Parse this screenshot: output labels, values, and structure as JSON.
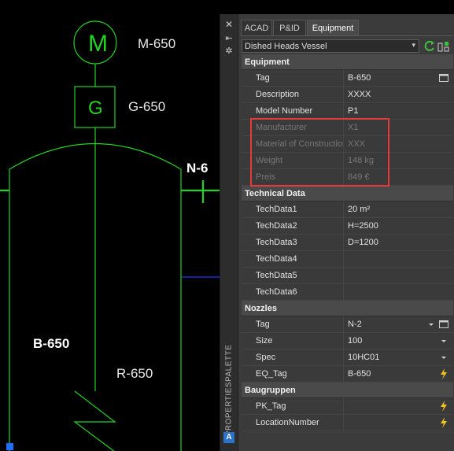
{
  "drawing": {
    "motor_symbol": "M",
    "motor_tag": "M-650",
    "gear_symbol": "G",
    "gear_tag": "G-650",
    "nozzle_tag": "N-6",
    "vessel_tag": "B-650",
    "agitator_tag": "R-650"
  },
  "palette": {
    "vertical_title": "PROPERTIESPALETTE",
    "close_glyph": "✕",
    "pin_glyph": "⇤",
    "settings_glyph": "✲",
    "logo_letter": "A",
    "tabs": [
      {
        "label": "ACAD",
        "active": false
      },
      {
        "label": "P&ID",
        "active": false
      },
      {
        "label": "Equipment",
        "active": true
      }
    ],
    "selector_value": "Dished Heads Vessel",
    "selector_arrow": "▾",
    "sections": {
      "equipment": {
        "title": "Equipment",
        "rows": [
          {
            "key": "Tag",
            "value": "B-650",
            "icon": "dialog-icon"
          },
          {
            "key": "Description",
            "value": "XXXX"
          },
          {
            "key": "Model Number",
            "value": "P1"
          },
          {
            "key": "Manufacturer",
            "value": "X1",
            "dim": true
          },
          {
            "key": "Material of Construction",
            "value": "XXX",
            "dim": true
          },
          {
            "key": "Weight",
            "value": "148 kg",
            "dim": true
          },
          {
            "key": "Preis",
            "value": "849 €",
            "dim": true
          }
        ]
      },
      "technical": {
        "title": "Technical Data",
        "rows": [
          {
            "key": "TechData1",
            "value": "20 m²"
          },
          {
            "key": "TechData2",
            "value": "H=2500"
          },
          {
            "key": "TechData3",
            "value": "D=1200"
          },
          {
            "key": "TechData4",
            "value": ""
          },
          {
            "key": "TechData5",
            "value": ""
          },
          {
            "key": "TechData6",
            "value": ""
          }
        ]
      },
      "nozzles": {
        "title": "Nozzles",
        "rows": [
          {
            "key": "Tag",
            "value": "N-2",
            "icon": "dropdown-dialog-icon"
          },
          {
            "key": "Size",
            "value": "100",
            "icon": "dropdown-icon"
          },
          {
            "key": "Spec",
            "value": "10HC01",
            "icon": "dropdown-icon"
          },
          {
            "key": "EQ_Tag",
            "value": "B-650",
            "icon": "lightning-icon"
          }
        ]
      },
      "baugruppen": {
        "title": "Baugruppen",
        "rows": [
          {
            "key": "PK_Tag",
            "value": "",
            "icon": "lightning-icon"
          },
          {
            "key": "LocationNumber",
            "value": "",
            "icon": "lightning-icon"
          }
        ]
      }
    }
  },
  "colors": {
    "cad_line": "#22d422",
    "highlight": "#e53a3a",
    "lightning": "#f6c21b"
  }
}
